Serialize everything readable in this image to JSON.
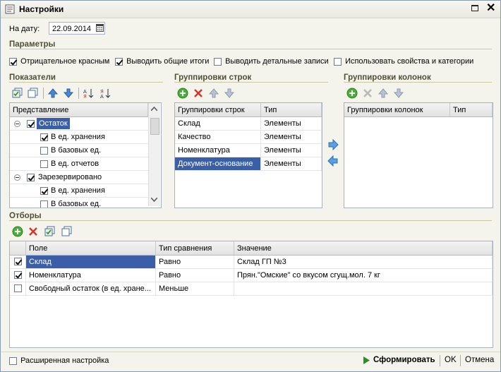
{
  "window": {
    "title": "Настройки"
  },
  "date": {
    "label": "На дату:",
    "value": "22.09.2014"
  },
  "params": {
    "title": "Параметры",
    "options": [
      {
        "label": "Отрицательное красным",
        "checked": true
      },
      {
        "label": "Выводить общие итоги",
        "checked": true
      },
      {
        "label": "Выводить детальные записи",
        "checked": false
      },
      {
        "label": "Использовать свойства и категории",
        "checked": false
      }
    ]
  },
  "indicators": {
    "title": "Показатели",
    "header": "Представление",
    "rows": [
      {
        "label": "Остаток",
        "level": 0,
        "checked": true,
        "selected": true
      },
      {
        "label": "В ед. хранения",
        "level": 1,
        "checked": true
      },
      {
        "label": "В базовых ед.",
        "level": 1,
        "checked": false
      },
      {
        "label": "В ед. отчетов",
        "level": 1,
        "checked": false
      },
      {
        "label": "Зарезервировано",
        "level": 0,
        "checked": true
      },
      {
        "label": "В ед. хранения",
        "level": 1,
        "checked": true
      },
      {
        "label": "В базовых ед.",
        "level": 1,
        "checked": false
      }
    ]
  },
  "row_groups": {
    "title": "Группировки строк",
    "col1": "Группировки строк",
    "col2": "Тип",
    "rows": [
      {
        "name": "Склад",
        "type": "Элементы"
      },
      {
        "name": "Качество",
        "type": "Элементы"
      },
      {
        "name": "Номенклатура",
        "type": "Элементы"
      },
      {
        "name": "Документ-основание",
        "type": "Элементы",
        "selected": true
      }
    ]
  },
  "col_groups": {
    "title": "Группировки колонок",
    "col1": "Группировки колонок",
    "col2": "Тип"
  },
  "filters": {
    "title": "Отборы",
    "col_field": "Поле",
    "col_cmp": "Тип сравнения",
    "col_value": "Значение",
    "rows": [
      {
        "checked": true,
        "field": "Склад",
        "cmp": "Равно",
        "value": "Склад ГП №3",
        "selected": true
      },
      {
        "checked": true,
        "field": "Номенклатура",
        "cmp": "Равно",
        "value": "Прян.\"Омские\" со вкусом сгущ.мол. 7 кг"
      },
      {
        "checked": false,
        "field": "Свободный остаток (в ед. хране...",
        "cmp": "Меньше",
        "value": ""
      }
    ]
  },
  "footer": {
    "advanced": "Расширенная настройка",
    "generate": "Сформировать",
    "ok": "OK",
    "cancel": "Отмена"
  },
  "colors": {
    "selection": "#3a5ea8",
    "accent_green": "#2e8b2e",
    "section_title": "#4f4f37"
  }
}
